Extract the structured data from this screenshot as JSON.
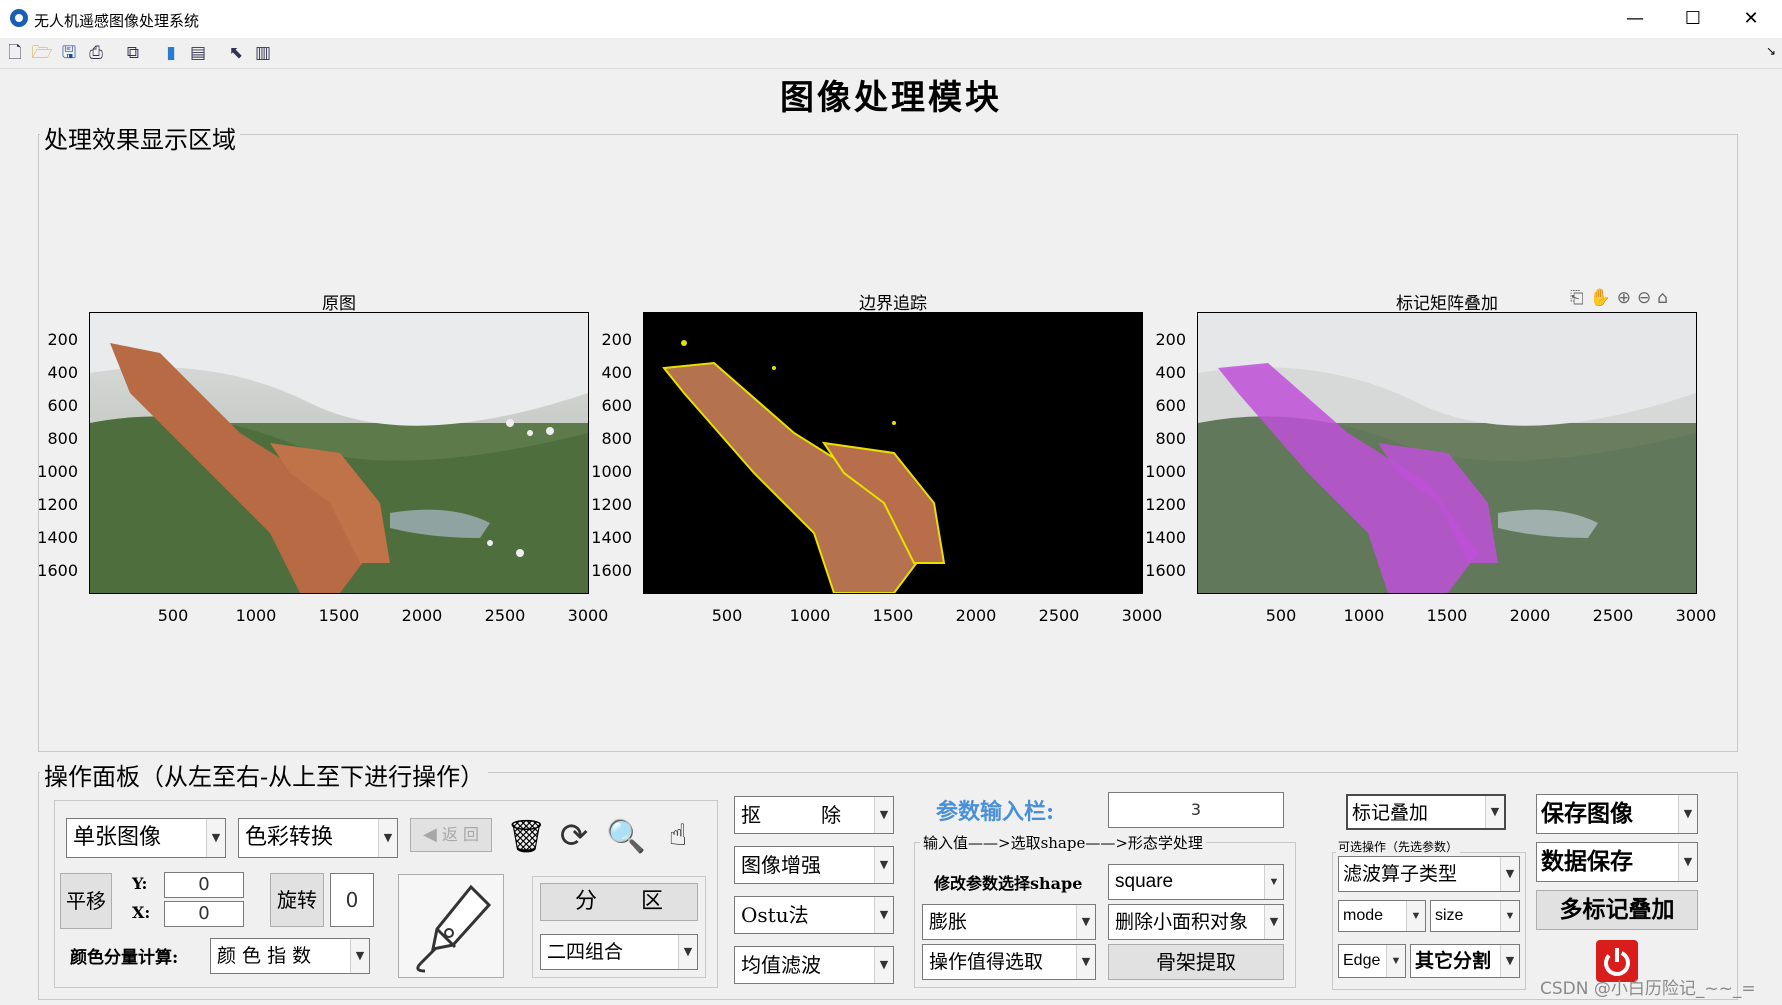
{
  "window": {
    "title": "无人机遥感图像处理系统",
    "minimize": "—",
    "maximize": "☐",
    "close": "✕"
  },
  "toolbar": {
    "icons": [
      "new-file-icon",
      "open-folder-icon",
      "save-icon",
      "print-icon",
      "print-preview-icon",
      "colorbar-icon",
      "legend-icon",
      "pointer-icon",
      "property-editor-icon"
    ],
    "dock_arrow": "↘"
  },
  "page": {
    "heading": "图像处理模块"
  },
  "display_panel": {
    "title": "处理效果显示区域",
    "axes": [
      {
        "title": "原图"
      },
      {
        "title": "边界追踪"
      },
      {
        "title": "标记矩阵叠加"
      }
    ],
    "y_ticks": [
      "200",
      "400",
      "600",
      "800",
      "1000",
      "1200",
      "1400",
      "1600"
    ],
    "x_ticks": [
      "500",
      "1000",
      "1500",
      "2000",
      "2500",
      "3000"
    ]
  },
  "operation_panel": {
    "title": "操作面板（从左至右-从上至下进行操作）",
    "image_mode": "单张图像",
    "color_convert": "色彩转换",
    "back_button": "返 回",
    "pan_button": "平移",
    "y_label": "Y:",
    "y_value": "0",
    "x_label": "X:",
    "x_value": "0",
    "rotate_button": "旋转",
    "rotate_value": "0",
    "color_calc_label": "颜色分量计算:",
    "color_index": "颜 色 指 数",
    "partition_button": "分　　区",
    "partition_combo": "二四组合",
    "matting": "抠　　　除",
    "enhance": "图像增强",
    "ostu": "Ostu法",
    "mean_filter": "均值滤波",
    "param_label": "参数输入栏:",
    "param_value": "3",
    "morph_group_title": "输入值——>选取shape——>形态学处理",
    "modify_shape_label": "修改参数选择shape",
    "shape_value": "square",
    "dilate": "膨胀",
    "remove_small": "删除小面积对象",
    "op_value_pick": "操作值得选取",
    "skeleton_button": "骨架提取",
    "mark_overlay": "标记叠加",
    "optional_group_title": "可选操作（先选参数）",
    "filter_type": "滤波算子类型",
    "mode": "mode",
    "size": "size",
    "edge": "Edge",
    "other_seg": "其它分割",
    "save_image": "保存图像",
    "save_data": "数据保存",
    "multi_overlay_button": "多标记叠加",
    "watermark": "CSDN @小白历险记_~~_="
  },
  "colors": {
    "accent_blue": "#4a90d9",
    "power_red": "#d91c1c",
    "mark_yellow": "#e8e000",
    "mark_magenta": "#c050d8"
  }
}
